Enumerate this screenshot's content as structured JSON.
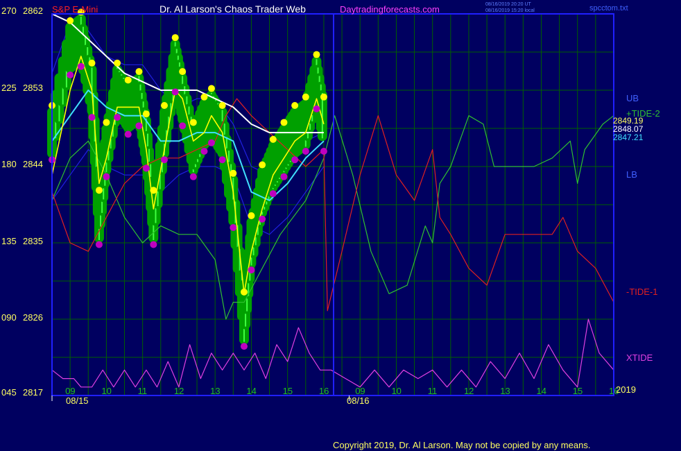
{
  "header": {
    "instrument": "S&P E-Mini",
    "title": "Dr. Al Larson's Chaos Trader Web",
    "site": "Daytradingforecasts.com",
    "timestamp_ut": "08/16/2019 20:20 UT",
    "timestamp_local": "08/16/2019 15:20 local",
    "file": "spcctom.txt"
  },
  "footer": {
    "copyright": "Copyright 2019, Dr. Al Larson. May not be copied by any means."
  },
  "colors": {
    "background": "#000060",
    "grid": "#006000",
    "frame": "#2020ff",
    "price_green": "#00a000",
    "price_light": "#40ff40",
    "yellow": "#ffff00",
    "magenta": "#c000c0",
    "white": "#ffffff",
    "cyan": "#40e0ff",
    "tide2": "#30c030",
    "tide1": "#e02020",
    "xtide": "#e040e0",
    "bands": "#2020e0"
  },
  "chart_data": {
    "type": "line",
    "y_left_ticks": [
      {
        "tide": "270",
        "price": "2862"
      },
      {
        "tide": "225",
        "price": "2853"
      },
      {
        "tide": "180",
        "price": "2844"
      },
      {
        "tide": "135",
        "price": "2835"
      },
      {
        "tide": "090",
        "price": "2826"
      },
      {
        "tide": "045",
        "price": "2817"
      }
    ],
    "ylim": [
      2817,
      2862
    ],
    "x_hour_labels": [
      "09",
      "10",
      "11",
      "12",
      "13",
      "14",
      "15",
      "16",
      "09",
      "10",
      "11",
      "12",
      "13",
      "14",
      "15",
      "16"
    ],
    "x_date_labels": [
      "08/15",
      "08/16"
    ],
    "year_label": "2019",
    "right_labels": {
      "ub": "UB",
      "tide2": "+TIDE-2",
      "lb": "LB",
      "tide1": "-TIDE-1",
      "xtide": "XTIDE",
      "last_values": [
        "2849.19",
        "2848.07",
        "2847.21"
      ]
    },
    "series": [
      {
        "name": "price",
        "x": [
          8.5,
          9.0,
          9.3,
          9.6,
          9.8,
          10.0,
          10.3,
          10.6,
          10.9,
          11.1,
          11.3,
          11.6,
          11.9,
          12.1,
          12.4,
          12.7,
          12.9,
          13.2,
          13.5,
          13.8,
          14.0,
          14.3,
          14.6,
          14.9,
          15.2,
          15.5,
          15.8,
          16.0
        ],
        "values": [
          2848,
          2858,
          2859,
          2853,
          2838,
          2846,
          2853,
          2851,
          2852,
          2847,
          2838,
          2848,
          2856,
          2852,
          2846,
          2849,
          2850,
          2848,
          2840,
          2826,
          2835,
          2841,
          2844,
          2846,
          2848,
          2849,
          2854,
          2849
        ]
      },
      {
        "name": "yellow_ma",
        "x": [
          8.5,
          9.0,
          9.3,
          9.6,
          9.8,
          10.0,
          10.3,
          10.6,
          10.9,
          11.1,
          11.3,
          11.6,
          11.9,
          12.1,
          12.4,
          12.7,
          12.9,
          13.2,
          13.5,
          13.8,
          14.0,
          14.3,
          14.6,
          14.9,
          15.2,
          15.5,
          15.8,
          16.0
        ],
        "values": [
          2843,
          2853,
          2857,
          2853,
          2842,
          2845,
          2851,
          2851,
          2851,
          2846,
          2839,
          2846,
          2853,
          2852,
          2847,
          2848,
          2850,
          2848,
          2841,
          2829,
          2834,
          2839,
          2843,
          2845,
          2847,
          2848,
          2852,
          2849
        ]
      },
      {
        "name": "white_ma",
        "x": [
          8.5,
          9.0,
          9.5,
          10.0,
          10.5,
          11.0,
          11.5,
          12.0,
          12.5,
          13.0,
          13.5,
          14.0,
          14.5,
          15.0,
          15.5,
          16.0
        ],
        "values": [
          2862,
          2861,
          2859,
          2857,
          2855,
          2854,
          2853,
          2853,
          2853,
          2852,
          2851,
          2849,
          2848,
          2848,
          2848,
          2848
        ]
      },
      {
        "name": "cyan_ma",
        "x": [
          8.5,
          9.0,
          9.5,
          10.0,
          10.5,
          11.0,
          11.5,
          12.0,
          12.5,
          13.0,
          13.5,
          14.0,
          14.5,
          15.0,
          15.5,
          16.0
        ],
        "values": [
          2847,
          2850,
          2853,
          2851,
          2850,
          2850,
          2847,
          2847,
          2848,
          2848,
          2847,
          2841,
          2840,
          2842,
          2845,
          2847
        ]
      },
      {
        "name": "UB",
        "x": [
          8.5,
          9.0,
          9.5,
          10.0,
          10.5,
          11.0,
          11.5,
          12.0,
          12.5,
          13.0,
          13.5,
          14.0,
          14.5,
          15.0,
          15.5,
          16.0
        ],
        "values": [
          2855,
          2861,
          2860,
          2857,
          2856,
          2856,
          2853,
          2851,
          2852,
          2852,
          2849,
          2844,
          2843,
          2845,
          2847,
          2848
        ]
      },
      {
        "name": "LB",
        "x": [
          8.5,
          9.0,
          9.5,
          10.0,
          10.5,
          11.0,
          11.5,
          12.0,
          12.5,
          13.0,
          13.5,
          14.0,
          14.5,
          15.0,
          15.5,
          16.0
        ],
        "values": [
          2840,
          2843,
          2846,
          2844,
          2843,
          2843,
          2841,
          2843,
          2844,
          2844,
          2843,
          2837,
          2836,
          2838,
          2841,
          2844
        ]
      },
      {
        "name": "+TIDE-2",
        "x": [
          8.5,
          9.0,
          9.5,
          10.0,
          10.5,
          11.0,
          11.5,
          12.0,
          12.5,
          13.0,
          13.3,
          13.5,
          13.8,
          14.3,
          14.8,
          15.5,
          16.0,
          16.3,
          16.8,
          17.3,
          17.8,
          18.3,
          18.8,
          19.0,
          19.2,
          19.5,
          20.0,
          20.4,
          20.7,
          21.0,
          21.3,
          21.5,
          21.8,
          22.3,
          22.8,
          23.0,
          23.2,
          23.7,
          24.0
        ],
        "values": [
          2840,
          2845,
          2847,
          2843,
          2838,
          2835,
          2837,
          2836,
          2836,
          2833,
          2826,
          2828,
          2828,
          2832,
          2836,
          2840,
          2845,
          2850,
          2843,
          2834,
          2829,
          2830,
          2837,
          2835,
          2842,
          2844,
          2850,
          2849,
          2844,
          2844,
          2844,
          2844,
          2844,
          2845,
          2847,
          2842,
          2846,
          2849,
          2850
        ]
      },
      {
        "name": "-TIDE-1",
        "x": [
          8.5,
          9.0,
          9.5,
          10.0,
          10.5,
          11.0,
          11.5,
          12.0,
          12.5,
          13.0,
          13.3,
          13.6,
          14.0,
          14.5,
          15.0,
          15.5,
          16.0,
          16.1,
          16.5,
          17.0,
          17.5,
          18.0,
          18.5,
          19.0,
          19.2,
          19.5,
          20.0,
          20.5,
          21.0,
          21.3,
          21.5,
          21.8,
          22.3,
          22.6,
          23.0,
          23.5,
          24.0
        ],
        "values": [
          2841,
          2835,
          2834,
          2838,
          2842,
          2844,
          2845,
          2845,
          2846,
          2847,
          2850,
          2852,
          2850,
          2848,
          2846,
          2844,
          2846,
          2827,
          2834,
          2843,
          2850,
          2843,
          2840,
          2846,
          2838,
          2836,
          2832,
          2830,
          2836,
          2836,
          2836,
          2836,
          2836,
          2838,
          2834,
          2832,
          2828
        ]
      },
      {
        "name": "XTIDE",
        "x": [
          8.5,
          8.8,
          9.1,
          9.3,
          9.6,
          9.9,
          10.2,
          10.5,
          10.8,
          11.1,
          11.4,
          11.7,
          12.0,
          12.3,
          12.6,
          12.9,
          13.2,
          13.5,
          13.8,
          14.1,
          14.4,
          14.7,
          15.0,
          15.3,
          15.6,
          15.9,
          16.2,
          16.6,
          17.0,
          17.4,
          17.8,
          18.2,
          18.6,
          19.0,
          19.4,
          19.8,
          20.2,
          20.6,
          21.0,
          21.4,
          21.8,
          22.2,
          22.6,
          23.0,
          23.3,
          23.6,
          24.0
        ],
        "values": [
          2820,
          2819,
          2819,
          2818,
          2818,
          2820,
          2818,
          2820,
          2818,
          2820,
          2818,
          2821,
          2818,
          2823,
          2819,
          2822,
          2820,
          2822,
          2820,
          2822,
          2819,
          2823,
          2821,
          2825,
          2822,
          2820,
          2820,
          2819,
          2818,
          2820,
          2818,
          2820,
          2819,
          2820,
          2818,
          2820,
          2818,
          2821,
          2819,
          2822,
          2819,
          2823,
          2820,
          2818,
          2826,
          2822,
          2820
        ]
      }
    ]
  }
}
